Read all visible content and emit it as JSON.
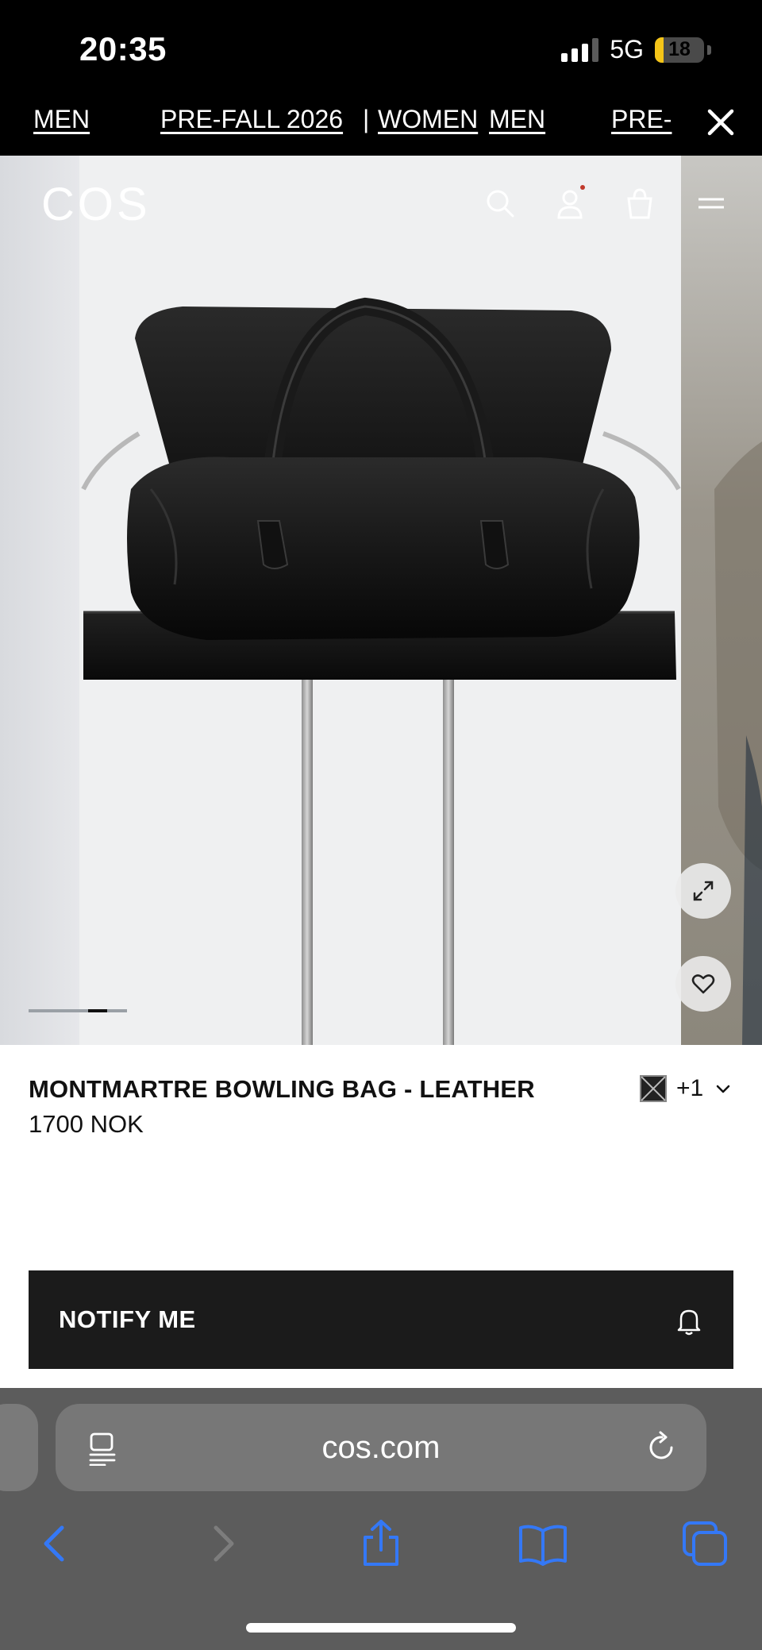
{
  "status_bar": {
    "time": "20:35",
    "network": "5G",
    "battery_level": "18",
    "battery_fraction": 0.18,
    "signal_bars_active": 3
  },
  "promo_banner": {
    "items": [
      "MEN",
      "PRE-FALL 2026",
      "WOMEN",
      "MEN",
      "PRE-"
    ],
    "separator": "|",
    "close_icon": "close-icon"
  },
  "header": {
    "logo": "COS",
    "icons": [
      "search-icon",
      "account-icon",
      "bag-icon",
      "menu-icon"
    ],
    "account_notification_color": "#c0392b"
  },
  "carousel": {
    "active_index": 3,
    "total": 5
  },
  "product": {
    "name": "MONTMARTRE BOWLING BAG - LEATHER",
    "price": "1700 NOK",
    "swatch_count": "+1"
  },
  "cta": {
    "notify_label": "NOTIFY ME"
  },
  "browser": {
    "url": "cos.com",
    "toolbar_icons": [
      "back-icon",
      "forward-icon",
      "share-icon",
      "bookmarks-icon",
      "tabs-icon"
    ],
    "accent": "#3478f6"
  }
}
